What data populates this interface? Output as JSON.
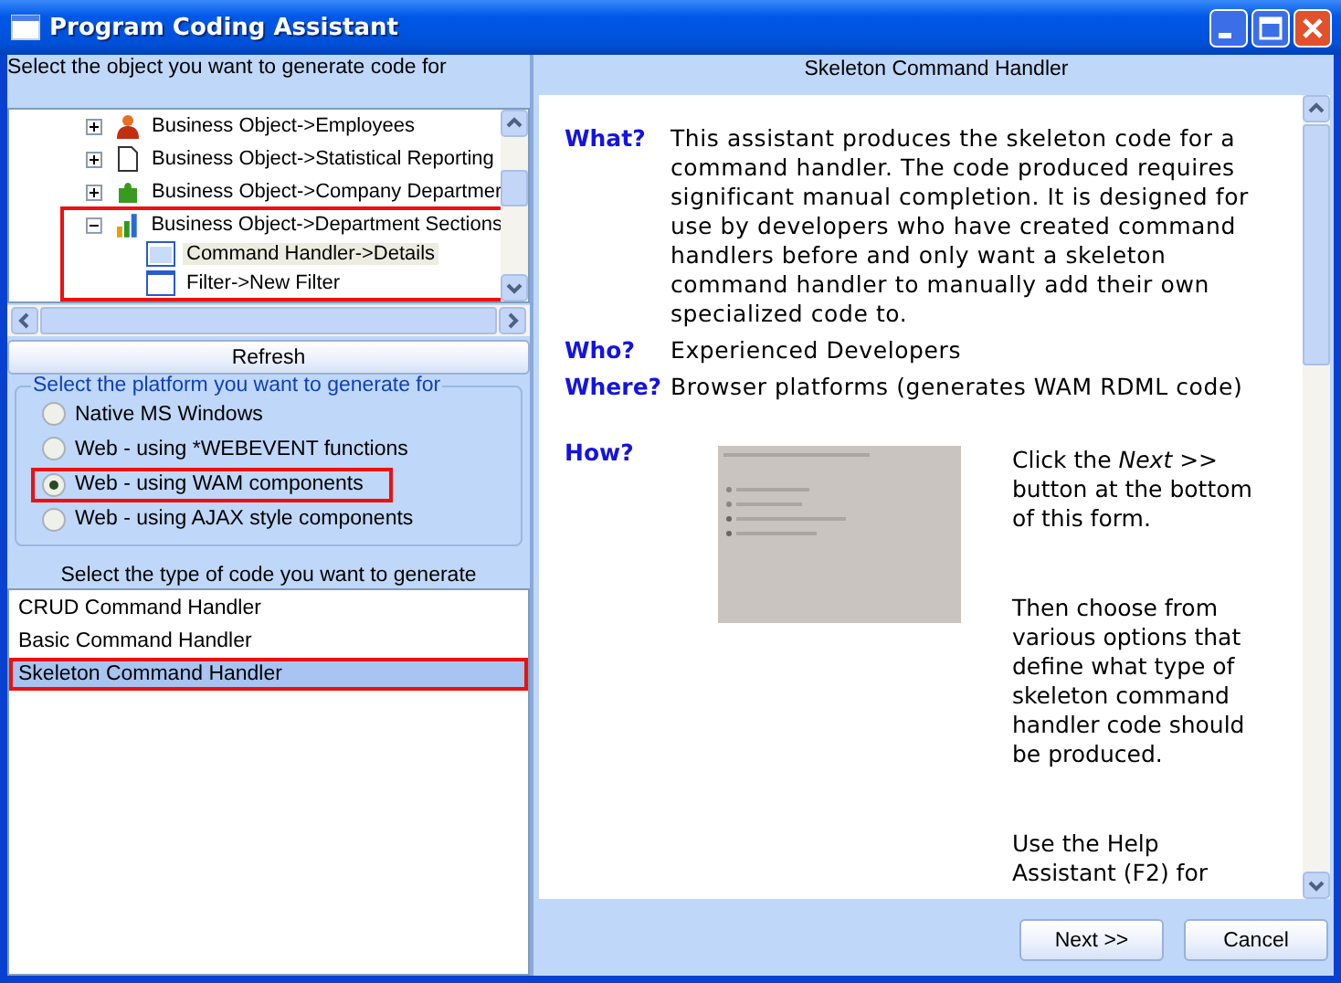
{
  "window": {
    "title": "Program Coding Assistant"
  },
  "object_prompt": "Select the object you want to generate code for",
  "tree": [
    {
      "label": "Business Object->Employees",
      "kind": "person",
      "expanded": false,
      "selected": false,
      "highlighted": false
    },
    {
      "label": "Business Object->Statistical Reporting",
      "kind": "document",
      "expanded": false,
      "selected": false,
      "highlighted": false
    },
    {
      "label": "Business Object->Company Departmer",
      "kind": "puzzle",
      "expanded": false,
      "selected": false,
      "highlighted": false
    },
    {
      "label": "Business Object->Department Sections",
      "kind": "chart",
      "expanded": true,
      "selected": false,
      "highlighted": true,
      "children": [
        {
          "label": "Command Handler->Details",
          "kind": "window",
          "selected": true
        },
        {
          "label": "Filter->New Filter",
          "kind": "form",
          "selected": false
        }
      ]
    }
  ],
  "refresh_button": "Refresh",
  "platform_group": {
    "legend": "Select the platform you want to generate for",
    "options": [
      {
        "label": "Native MS Windows",
        "selected": false,
        "highlighted": false
      },
      {
        "label": "Web - using *WEBEVENT functions",
        "selected": false,
        "highlighted": false
      },
      {
        "label": "Web - using WAM components",
        "selected": true,
        "highlighted": true
      },
      {
        "label": "Web - using AJAX style components",
        "selected": false,
        "highlighted": false
      }
    ]
  },
  "code_type_prompt": "Select the type of code you want to generate",
  "code_types": [
    {
      "label": "CRUD Command Handler",
      "selected": false,
      "highlighted": false
    },
    {
      "label": "Basic Command Handler",
      "selected": false,
      "highlighted": false
    },
    {
      "label": "Skeleton Command Handler",
      "selected": true,
      "highlighted": true
    }
  ],
  "detail": {
    "title": "Skeleton Command Handler",
    "sections": [
      {
        "kind": "text",
        "label": "What?",
        "text": "This assistant produces the skeleton code for a command handler. The code produced requires significant manual completion. It is designed for use by developers who have created command handlers before and only want a skeleton command handler to manually add their own specialized code to."
      },
      {
        "kind": "text",
        "label": "Who?",
        "text": "Experienced Developers"
      },
      {
        "kind": "text",
        "label": "Where?",
        "text": "Browser platforms (generates WAM RDML code)"
      },
      {
        "kind": "picture",
        "label": "How?",
        "paragraphs": [
          "Click the *Next* >> button at the bottom of this form.",
          "Then choose from various options that define what type of skeleton command handler code should be produced.",
          "Use the Help Assistant (F2) for"
        ]
      }
    ]
  },
  "buttons": [
    "Next >>",
    "Cancel"
  ]
}
